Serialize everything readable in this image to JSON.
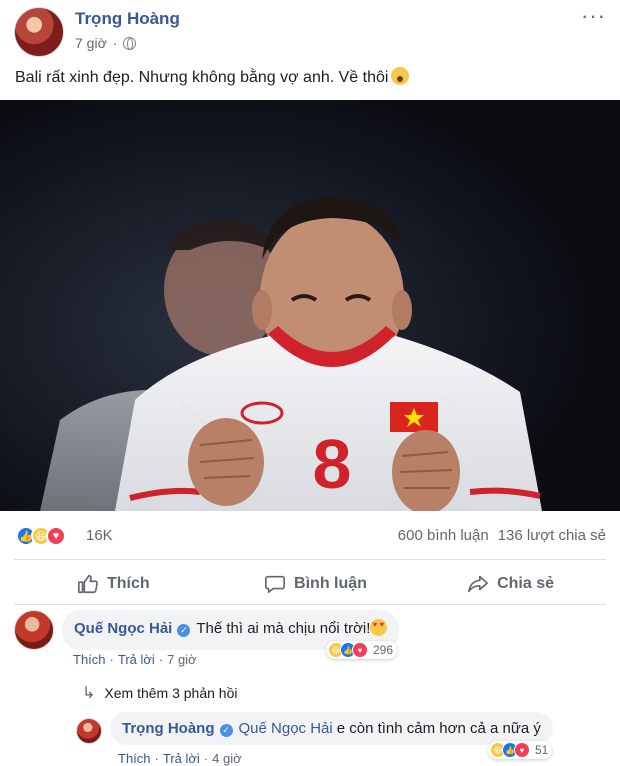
{
  "post": {
    "author": "Trọng Hoàng",
    "time": "7 giờ",
    "text": "Bali rất xinh đẹp. Nhưng không bằng vợ anh. Về thôi",
    "more_icon": "more-dots-icon",
    "privacy_icon": "globe-icon"
  },
  "photo": {
    "jersey_number": "8"
  },
  "stats": {
    "reactions_count": "16K",
    "comments": "600 bình luận",
    "shares": "136 lượt chia sẻ"
  },
  "actions": {
    "like": "Thích",
    "comment": "Bình luận",
    "share": "Chia sẻ"
  },
  "comments": [
    {
      "author": "Quế Ngọc Hải",
      "text": "Thế thì ai mà chịu nổi trời!",
      "reactions": "296",
      "like": "Thích",
      "reply": "Trả lời",
      "time": "7 giờ"
    }
  ],
  "more_replies": "Xem thêm 3 phản hồi",
  "reply": {
    "author": "Trọng Hoàng",
    "mention": "Quế Ngọc Hải",
    "text": "e còn tình cảm hơn cả a nữa ý",
    "reactions": "51",
    "like": "Thích",
    "reply": "Trả lời",
    "time": "4 giờ"
  },
  "colors": {
    "link_blue": "#385898",
    "like_blue": "#1877f2",
    "love_red": "#f33e58",
    "haha_yellow": "#f7c948",
    "jersey_red": "#d0222b"
  }
}
